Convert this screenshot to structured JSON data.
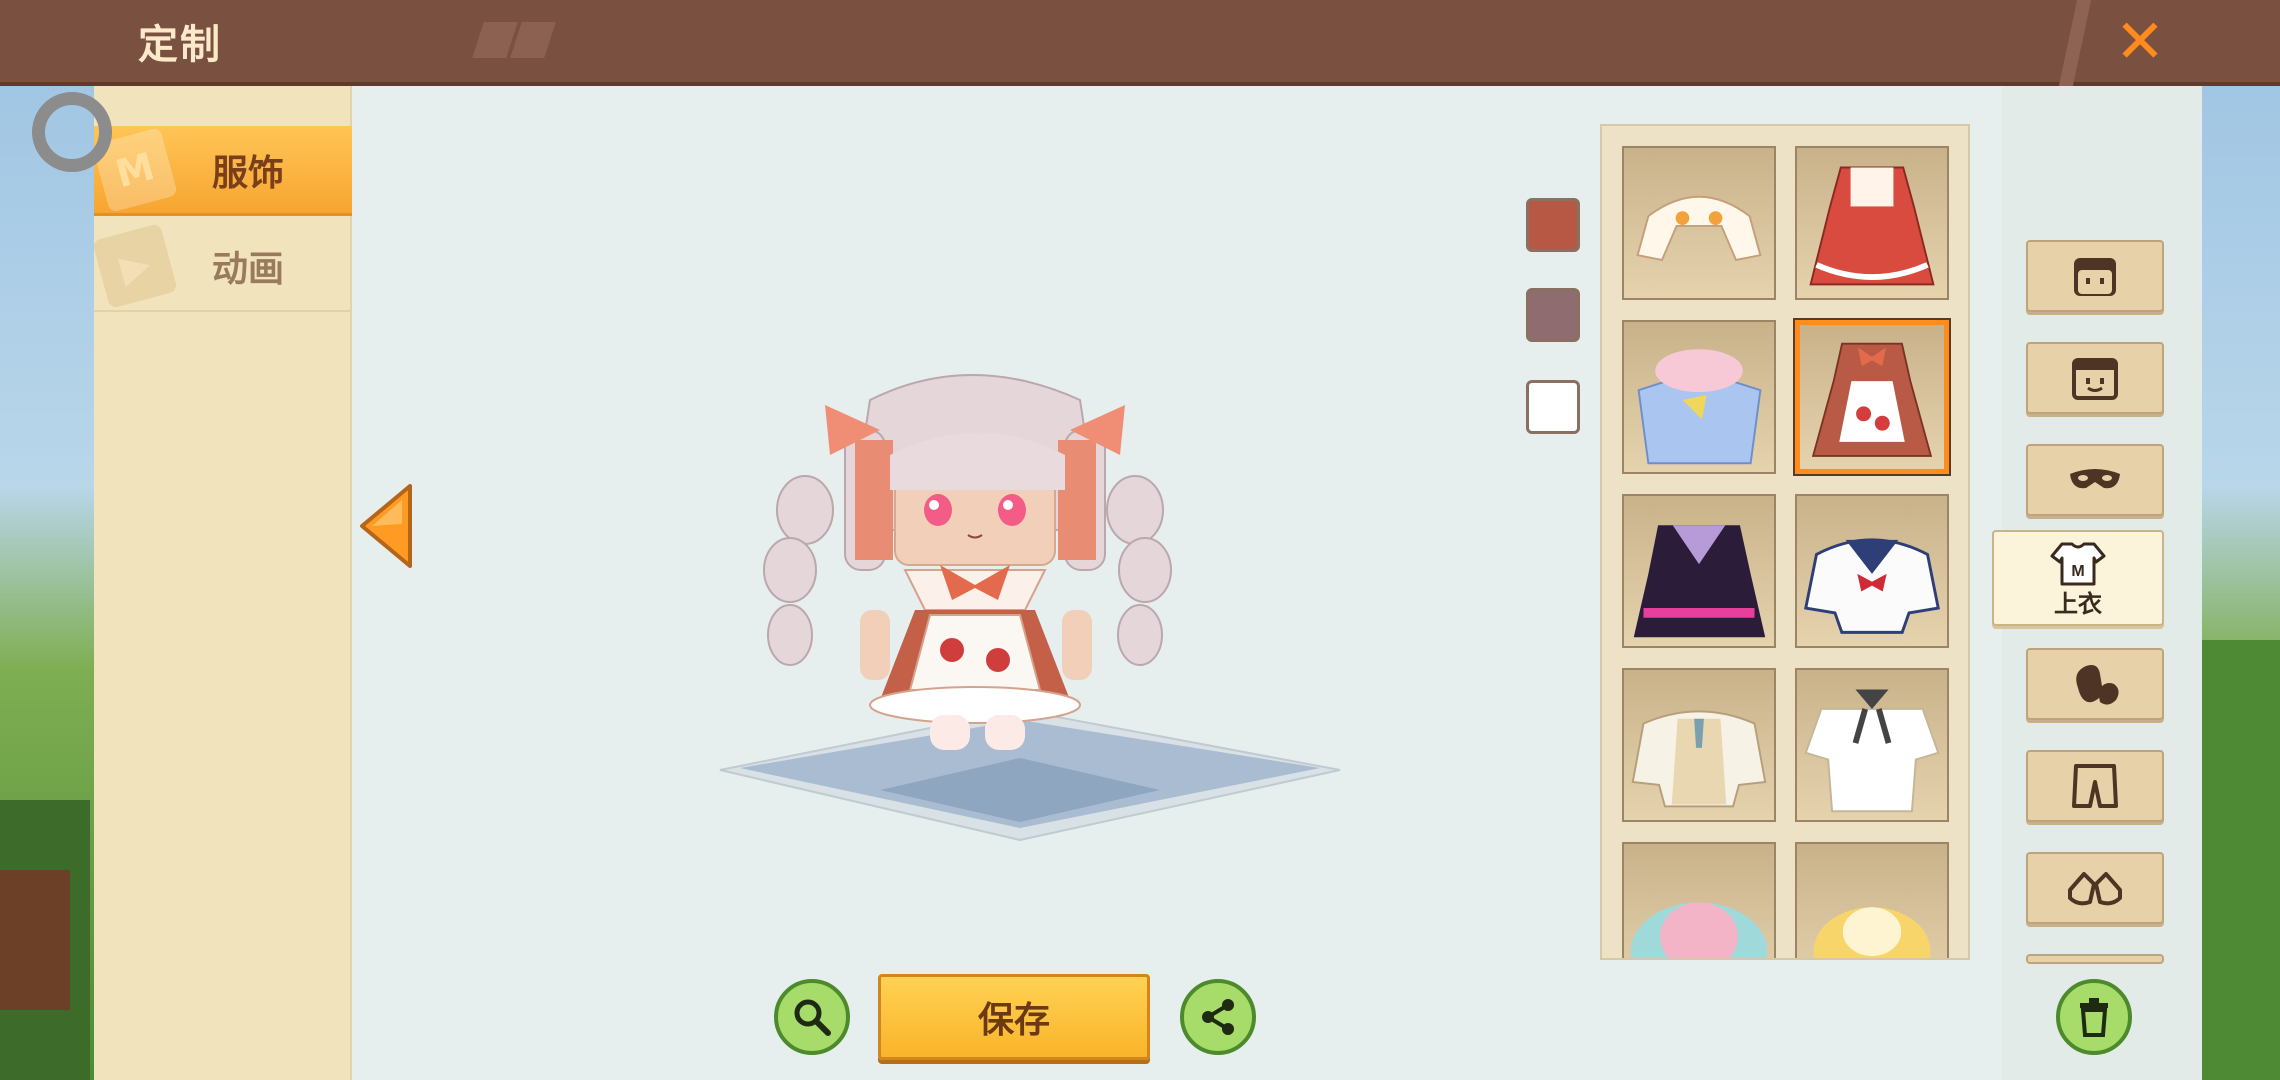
{
  "header": {
    "title": "定制",
    "close_icon": "close-icon",
    "accent": "#ff8a1e"
  },
  "sidebar": {
    "tabs": [
      {
        "label": "服饰",
        "icon": "clothing-icon",
        "active": true
      },
      {
        "label": "动画",
        "icon": "animation-icon",
        "active": false
      }
    ]
  },
  "colors": {
    "swatches": [
      "#b65844",
      "#8e6c70",
      "#ffffff"
    ],
    "selected_border": "#ff8d1c"
  },
  "items": [
    {
      "name": "floral-bolero",
      "selected": false
    },
    {
      "name": "red-frill-dress",
      "selected": false
    },
    {
      "name": "gift-box-outfit",
      "selected": false
    },
    {
      "name": "strawberry-maid-dress",
      "selected": true
    },
    {
      "name": "pink-black-sailor-dress",
      "selected": false
    },
    {
      "name": "white-sailor-top",
      "selected": false
    },
    {
      "name": "cream-vest-shirt",
      "selected": false
    },
    {
      "name": "white-tee-ribbon",
      "selected": false
    },
    {
      "name": "pastel-ruffle-top",
      "selected": false
    },
    {
      "name": "yellow-frill-top",
      "selected": false
    }
  ],
  "categories": [
    {
      "icon": "hair-icon"
    },
    {
      "icon": "face-icon"
    },
    {
      "icon": "mask-icon"
    },
    {
      "icon": "top-icon",
      "label": "上衣",
      "active": true
    },
    {
      "icon": "gloves-icon"
    },
    {
      "icon": "pants-icon"
    },
    {
      "icon": "shoes-icon"
    }
  ],
  "bottom": {
    "save_label": "保存",
    "zoom_icon": "zoom-icon",
    "share_icon": "share-icon",
    "trash_icon": "trash-icon"
  }
}
